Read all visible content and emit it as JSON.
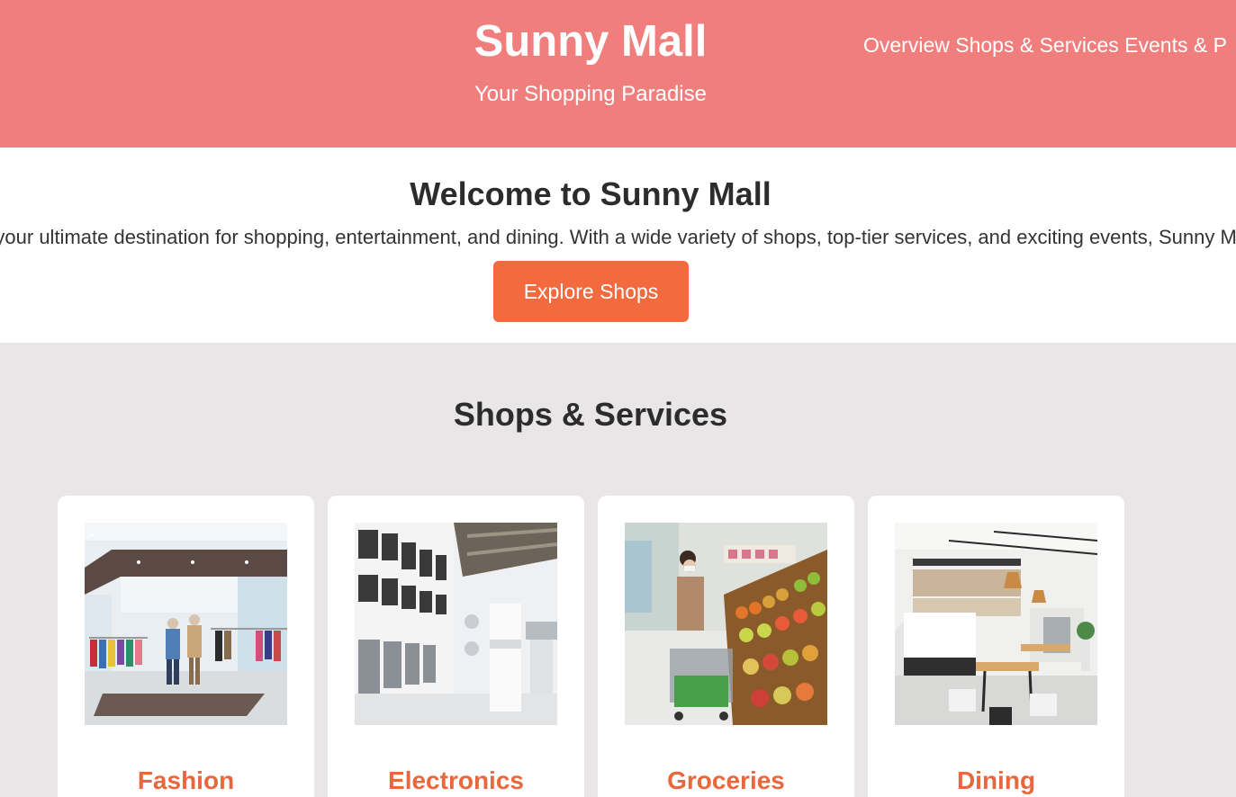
{
  "header": {
    "title": "Sunny Mall",
    "subtitle": "Your Shopping Paradise",
    "nav_text": "Overview Shops & Services Events & P"
  },
  "welcome": {
    "title": "Welcome to Sunny Mall",
    "text": "Sunny Mall is your ultimate destination for shopping, entertainment, and dining. With a wide variety of shops, top-tier services, and exciting events, Sunny Mall is the",
    "button_label": "Explore Shops"
  },
  "shops": {
    "title": "Shops & Services",
    "cards": [
      {
        "label": "Fashion",
        "image": "fashion-store-photo"
      },
      {
        "label": "Electronics",
        "image": "electronics-store-photo"
      },
      {
        "label": "Groceries",
        "image": "grocery-store-photo"
      },
      {
        "label": "Dining",
        "image": "restaurant-photo"
      }
    ]
  },
  "colors": {
    "header_bg": "#f07e7d",
    "accent": "#f26a3d",
    "card_label": "#e9673d",
    "section_bg": "#e8e6e6"
  }
}
